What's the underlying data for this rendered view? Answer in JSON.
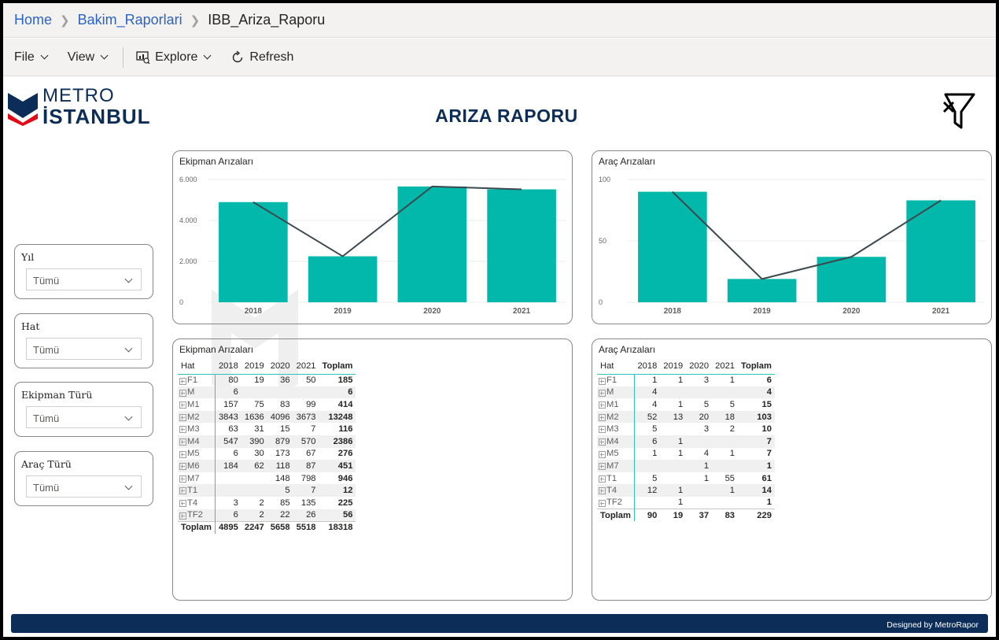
{
  "breadcrumb": {
    "home": "Home",
    "folder": "Bakim_Raporlari",
    "report": "IBB_Ariza_Raporu"
  },
  "toolbar": {
    "file": "File",
    "view": "View",
    "explore": "Explore",
    "refresh": "Refresh"
  },
  "logo": {
    "line1": "METRO",
    "line2": "İSTANBUL"
  },
  "report_title": "ARIZA RAPORU",
  "colors": {
    "bar": "#01b8aa",
    "line": "#3c4a4f",
    "navy": "#0c2d57",
    "logo_red": "#e30a17"
  },
  "slicers": [
    {
      "label": "Yıl",
      "value": "Tümü"
    },
    {
      "label": "Hat",
      "value": "Tümü"
    },
    {
      "label": "Ekipman Türü",
      "value": "Tümü"
    },
    {
      "label": "Araç Türü",
      "value": "Tümü"
    }
  ],
  "chart_data": [
    {
      "type": "bar",
      "title": "Ekipman Arızaları",
      "categories": [
        "2018",
        "2019",
        "2020",
        "2021"
      ],
      "series": [
        {
          "type": "bar",
          "values": [
            4895,
            2247,
            5658,
            5518
          ]
        },
        {
          "type": "line",
          "values": [
            4895,
            2247,
            5658,
            5518
          ]
        }
      ],
      "ylim": [
        0,
        6000
      ],
      "yticks": [
        0,
        2000,
        4000,
        6000
      ],
      "ytick_labels": [
        "0",
        "2.000",
        "4.000",
        "6.000"
      ],
      "grid": true,
      "xlabel": "",
      "ylabel": ""
    },
    {
      "type": "bar",
      "title": "Araç Arızaları",
      "categories": [
        "2018",
        "2019",
        "2020",
        "2021"
      ],
      "series": [
        {
          "type": "bar",
          "values": [
            90,
            19,
            37,
            83
          ]
        },
        {
          "type": "line",
          "values": [
            90,
            19,
            37,
            83
          ]
        }
      ],
      "ylim": [
        0,
        100
      ],
      "yticks": [
        0,
        50,
        100
      ],
      "ytick_labels": [
        "0",
        "50",
        "100"
      ],
      "grid": true,
      "xlabel": "",
      "ylabel": ""
    }
  ],
  "tables": [
    {
      "title": "Ekipman Arızaları",
      "columns": [
        "Hat",
        "2018",
        "2019",
        "2020",
        "2021",
        "Toplam"
      ],
      "rows": [
        [
          "F1",
          "80",
          "19",
          "36",
          "50",
          "185"
        ],
        [
          "M",
          "6",
          "",
          "",
          "",
          "6"
        ],
        [
          "M1",
          "157",
          "75",
          "83",
          "99",
          "414"
        ],
        [
          "M2",
          "3843",
          "1636",
          "4096",
          "3673",
          "13248"
        ],
        [
          "M3",
          "63",
          "31",
          "15",
          "7",
          "116"
        ],
        [
          "M4",
          "547",
          "390",
          "879",
          "570",
          "2386"
        ],
        [
          "M5",
          "6",
          "30",
          "173",
          "67",
          "276"
        ],
        [
          "M6",
          "184",
          "62",
          "118",
          "87",
          "451"
        ],
        [
          "M7",
          "",
          "",
          "148",
          "798",
          "946"
        ],
        [
          "T1",
          "",
          "",
          "5",
          "7",
          "12"
        ],
        [
          "T4",
          "3",
          "2",
          "85",
          "135",
          "225"
        ],
        [
          "TF2",
          "6",
          "2",
          "22",
          "26",
          "56"
        ]
      ],
      "total": [
        "Toplam",
        "4895",
        "2247",
        "5658",
        "5518",
        "18318"
      ]
    },
    {
      "title": "Araç Arızaları",
      "columns": [
        "Hat",
        "2018",
        "2019",
        "2020",
        "2021",
        "Toplam"
      ],
      "rows": [
        [
          "F1",
          "1",
          "1",
          "3",
          "1",
          "6"
        ],
        [
          "M",
          "4",
          "",
          "",
          "",
          "4"
        ],
        [
          "M1",
          "4",
          "1",
          "5",
          "5",
          "15"
        ],
        [
          "M2",
          "52",
          "13",
          "20",
          "18",
          "103"
        ],
        [
          "M3",
          "5",
          "",
          "3",
          "2",
          "10"
        ],
        [
          "M4",
          "6",
          "1",
          "",
          "",
          "7"
        ],
        [
          "M5",
          "1",
          "1",
          "4",
          "1",
          "7"
        ],
        [
          "M7",
          "",
          "",
          "1",
          "",
          "1"
        ],
        [
          "T1",
          "5",
          "",
          "1",
          "55",
          "61"
        ],
        [
          "T4",
          "12",
          "1",
          "",
          "1",
          "14"
        ],
        [
          "TF2",
          "",
          "1",
          "",
          "",
          "1"
        ]
      ],
      "total": [
        "Toplam",
        "90",
        "19",
        "37",
        "83",
        "229"
      ]
    }
  ],
  "footer": "Designed by MetroRapor"
}
